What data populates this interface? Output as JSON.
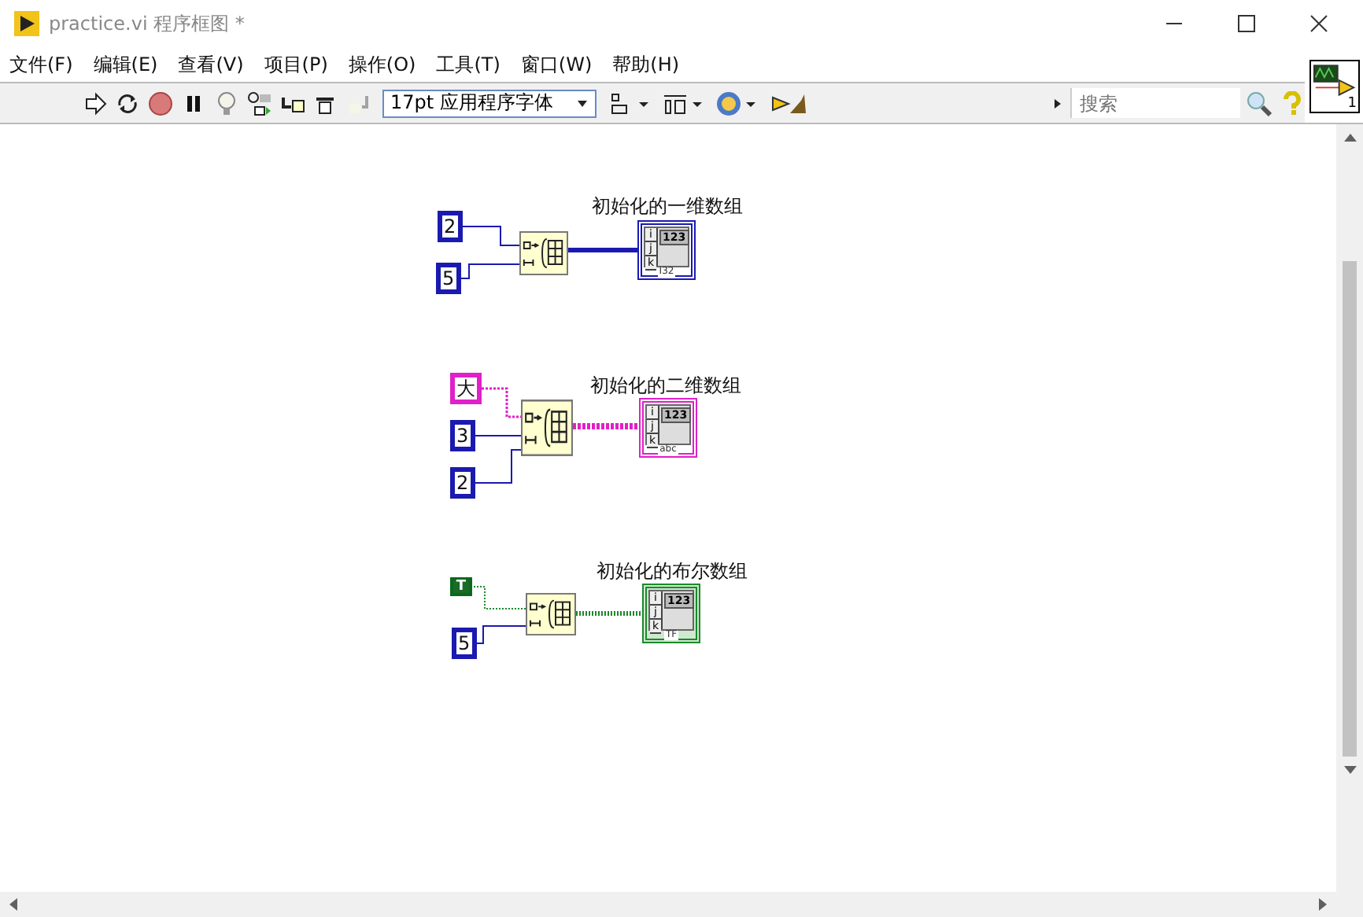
{
  "window": {
    "title": "practice.vi 程序框图 *"
  },
  "menu": [
    "文件(F)",
    "编辑(E)",
    "查看(V)",
    "项目(P)",
    "操作(O)",
    "工具(T)",
    "窗口(W)",
    "帮助(H)"
  ],
  "toolbar": {
    "step_out_disabled": true,
    "font": "17pt 应用程序字体",
    "search": {
      "placeholder": "搜索"
    },
    "connector_pane": {
      "label": "1"
    }
  },
  "diagram": {
    "groups": [
      {
        "kind": "numeric",
        "inputs": [
          "2",
          "5"
        ],
        "indicator": {
          "label": "初始化的一维数组",
          "index": [
            "i",
            "j",
            "k"
          ],
          "value": "123",
          "type": "I32"
        }
      },
      {
        "kind": "string",
        "inputs": [
          "大",
          "3",
          "2"
        ],
        "indicator": {
          "label": "初始化的二维数组",
          "index": [
            "i",
            "j",
            "k"
          ],
          "value": "123",
          "type": "abc"
        }
      },
      {
        "kind": "boolean",
        "inputs": [
          "T",
          "5"
        ],
        "indicator": {
          "label": "初始化的布尔数组",
          "index": [
            "i",
            "j",
            "k"
          ],
          "value": "123",
          "type": "TF"
        }
      }
    ]
  }
}
